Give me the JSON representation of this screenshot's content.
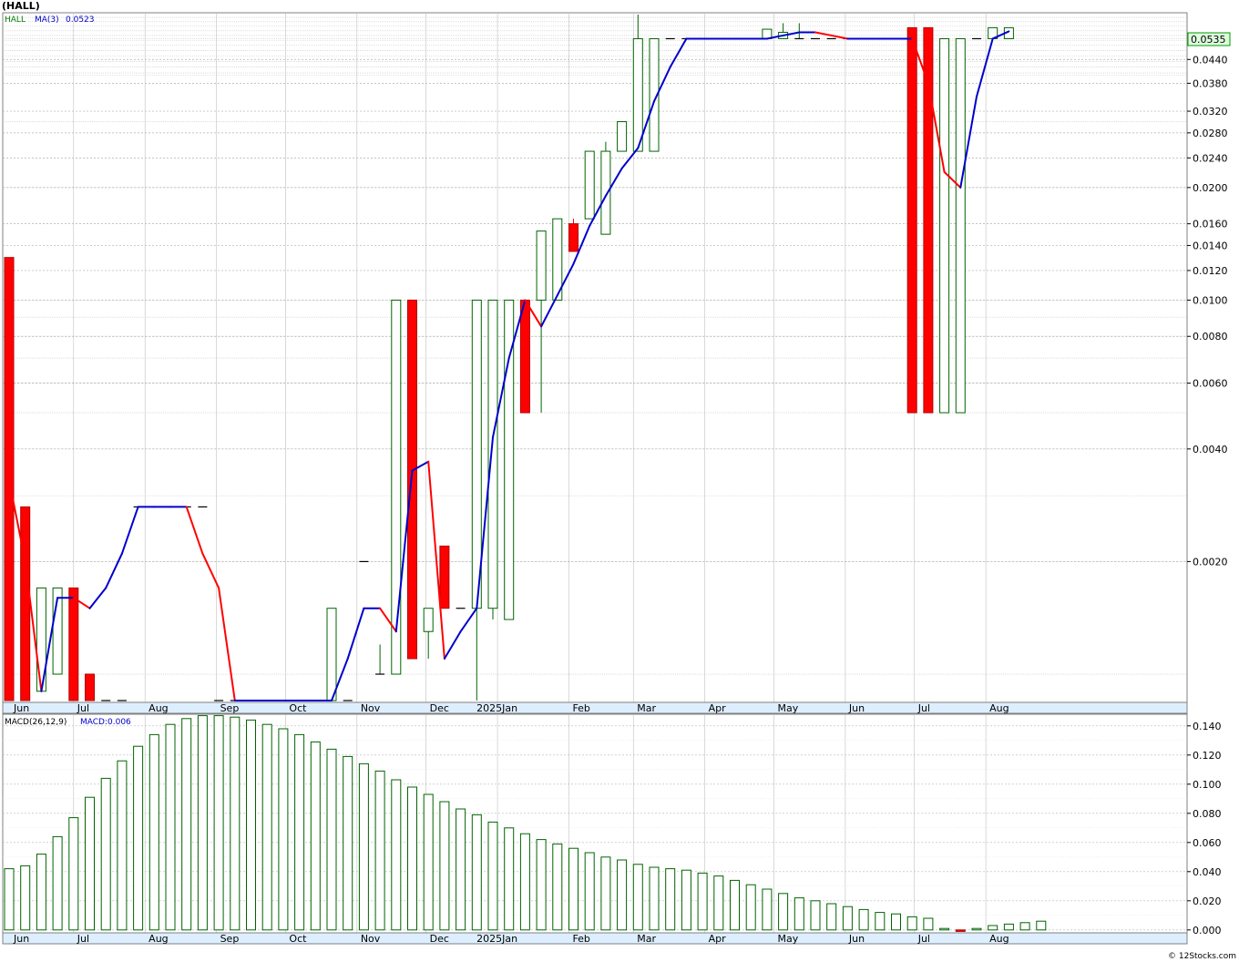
{
  "title": "(HALL)",
  "price_panel": {
    "legend": [
      {
        "label": "HALL",
        "color": "#008000"
      },
      {
        "label": "MA(3)",
        "color": "#0000cc"
      },
      {
        "label": "0.0523",
        "color": "#0000cc"
      }
    ],
    "last_price_label": "0.0535",
    "last_price": 0.0535,
    "y_ticks": [
      "0.0440",
      "0.0380",
      "0.0320",
      "0.0280",
      "0.0240",
      "0.0200",
      "0.0160",
      "0.0140",
      "0.0120",
      "0.0100",
      "0.0080",
      "0.0060",
      "0.0040",
      "0.0020"
    ]
  },
  "macd_panel": {
    "legend": [
      {
        "label": "MACD(26,12,9)",
        "color": "#000000"
      },
      {
        "label": "MACD:0.006",
        "color": "#0000cc"
      }
    ],
    "y_ticks": [
      "0.140",
      "0.120",
      "0.100",
      "0.080",
      "0.060",
      "0.040",
      "0.020",
      "0.000"
    ]
  },
  "x_labels": [
    "Jun",
    "Jul",
    "Aug",
    "Sep",
    "Oct",
    "Nov",
    "Dec",
    "2025Jan",
    "Feb",
    "Mar",
    "Apr",
    "May",
    "Jun",
    "Jul",
    "Aug"
  ],
  "footer": "© 12Stocks.com",
  "chart_data": [
    {
      "type": "candlestick",
      "title": "(HALL)",
      "scale": "log",
      "ylim": [
        0.00085,
        0.058
      ],
      "colors": {
        "up": "#006400",
        "down": "#ff0000",
        "ma_up": "#0000cc",
        "ma_down": "#ff0000"
      },
      "x": [
        "2024-06-03",
        "2024-06-10",
        "2024-06-17",
        "2024-06-24",
        "2024-07-01",
        "2024-07-08",
        "2024-07-15",
        "2024-07-22",
        "2024-07-29",
        "2024-08-05",
        "2024-08-12",
        "2024-08-19",
        "2024-08-26",
        "2024-09-02",
        "2024-09-09",
        "2024-09-16",
        "2024-09-23",
        "2024-09-30",
        "2024-10-07",
        "2024-10-14",
        "2024-10-21",
        "2024-10-28",
        "2024-11-04",
        "2024-11-11",
        "2024-11-18",
        "2024-11-25",
        "2024-12-02",
        "2024-12-09",
        "2024-12-16",
        "2024-12-23",
        "2024-12-30",
        "2025-01-06",
        "2025-01-13",
        "2025-01-20",
        "2025-01-27",
        "2025-02-03",
        "2025-02-10",
        "2025-02-17",
        "2025-02-24",
        "2025-03-03",
        "2025-03-10",
        "2025-03-17",
        "2025-03-24",
        "2025-03-31",
        "2025-04-07",
        "2025-04-14",
        "2025-04-21",
        "2025-04-28",
        "2025-05-05",
        "2025-05-12",
        "2025-05-19",
        "2025-05-26",
        "2025-06-02",
        "2025-06-09",
        "2025-06-16",
        "2025-06-23",
        "2025-06-30",
        "2025-07-07",
        "2025-07-14",
        "2025-07-21",
        "2025-07-28",
        "2025-08-04",
        "2025-08-11"
      ],
      "open": [
        0.013,
        0.0028,
        0.0009,
        0.001,
        0.0017,
        0.001,
        0.00085,
        0.00085,
        0.0028,
        0.0028,
        0.0028,
        0.0028,
        0.0028,
        0.00085,
        0.00085,
        0.00085,
        0.00085,
        0.00085,
        0.00085,
        0.00085,
        0.00085,
        0.00085,
        0.002,
        0.001,
        0.001,
        0.01,
        0.0013,
        0.0022,
        0.0015,
        0.0015,
        0.0015,
        0.0014,
        0.01,
        0.01,
        0.01,
        0.016,
        0.0165,
        0.015,
        0.025,
        0.025,
        0.025,
        0.05,
        0.05,
        0.05,
        0.05,
        0.05,
        0.05,
        0.05,
        0.05,
        0.05,
        0.05,
        0.05,
        0.05,
        0.05,
        0.05,
        0.05,
        0.0535,
        0.0535,
        0.005,
        0.005,
        0.05,
        0.05,
        0.05
      ],
      "high": [
        0.013,
        0.0028,
        0.0017,
        0.0017,
        0.0017,
        0.001,
        0.00085,
        0.00085,
        0.0028,
        0.0028,
        0.0028,
        0.0028,
        0.0028,
        0.00085,
        0.00085,
        0.00085,
        0.00085,
        0.00085,
        0.00085,
        0.00085,
        0.0015,
        0.00085,
        0.002,
        0.0012,
        0.01,
        0.01,
        0.0015,
        0.0022,
        0.0015,
        0.01,
        0.01,
        0.01,
        0.01,
        0.0153,
        0.0165,
        0.0165,
        0.025,
        0.0265,
        0.03,
        0.058,
        0.05,
        0.05,
        0.05,
        0.05,
        0.05,
        0.05,
        0.05,
        0.053,
        0.055,
        0.055,
        0.05,
        0.05,
        0.05,
        0.05,
        0.05,
        0.05,
        0.0535,
        0.0535,
        0.005,
        0.05,
        0.05,
        0.05,
        0.0535
      ],
      "low": [
        0.00085,
        0.00085,
        0.0009,
        0.001,
        0.001,
        0.00085,
        0.00085,
        0.00085,
        0.0028,
        0.0028,
        0.0028,
        0.0028,
        0.0028,
        0.00085,
        0.00085,
        0.00085,
        0.00085,
        0.00085,
        0.00085,
        0.00085,
        0.00085,
        0.00085,
        0.002,
        0.001,
        0.001,
        0.0011,
        0.0011,
        0.0015,
        0.0015,
        0.00085,
        0.0014,
        0.005,
        0.005,
        0.005,
        0.0135,
        0.0135,
        0.0245,
        0.025,
        0.025,
        0.038,
        0.05,
        0.05,
        0.05,
        0.05,
        0.05,
        0.05,
        0.05,
        0.05,
        0.052,
        0.05,
        0.05,
        0.05,
        0.05,
        0.05,
        0.05,
        0.05,
        0.005,
        0.005,
        0.005,
        0.005,
        0.05,
        0.05,
        0.05
      ],
      "close": [
        0.00085,
        0.00085,
        0.0017,
        0.0017,
        0.00085,
        0.00085,
        0.00085,
        0.00085,
        0.0028,
        0.0028,
        0.0028,
        0.0028,
        0.0028,
        0.00085,
        0.00085,
        0.00085,
        0.00085,
        0.00085,
        0.00085,
        0.00085,
        0.0015,
        0.00085,
        0.002,
        0.001,
        0.01,
        0.0011,
        0.0015,
        0.0015,
        0.0015,
        0.01,
        0.01,
        0.01,
        0.005,
        0.0153,
        0.0165,
        0.0135,
        0.025,
        0.025,
        0.03,
        0.05,
        0.05,
        0.05,
        0.05,
        0.05,
        0.05,
        0.05,
        0.05,
        0.053,
        0.052,
        0.05,
        0.05,
        0.05,
        0.05,
        0.05,
        0.05,
        0.05,
        0.005,
        0.005,
        0.05,
        0.05,
        0.05,
        0.0535,
        0.0535
      ],
      "series": [
        {
          "name": "MA(3)",
          "values": [
            0.0033,
            0.002,
            0.0009,
            0.0016,
            0.0016,
            0.0015,
            0.0017,
            0.0021,
            0.0028,
            0.0028,
            0.0028,
            0.0028,
            0.0021,
            0.0017,
            0.00085,
            0.00085,
            0.00085,
            0.00085,
            0.00085,
            0.00085,
            0.00085,
            0.0011,
            0.0015,
            0.0015,
            0.0013,
            0.0035,
            0.0037,
            0.0011,
            0.0013,
            0.0015,
            0.0043,
            0.007,
            0.01,
            0.0085,
            0.0103,
            0.0125,
            0.0158,
            0.019,
            0.0225,
            0.0255,
            0.034,
            0.042,
            0.05,
            0.05,
            0.05,
            0.05,
            0.05,
            0.05,
            0.051,
            0.052,
            0.052,
            0.051,
            0.05,
            0.05,
            0.05,
            0.05,
            0.05,
            0.038,
            0.022,
            0.02,
            0.035,
            0.05,
            0.0523
          ]
        }
      ]
    },
    {
      "type": "bar",
      "title": "MACD(26,12,9)",
      "ylim": [
        -0.002,
        0.148
      ],
      "values": [
        0.042,
        0.044,
        0.052,
        0.064,
        0.077,
        0.091,
        0.104,
        0.116,
        0.126,
        0.134,
        0.141,
        0.145,
        0.147,
        0.147,
        0.146,
        0.144,
        0.141,
        0.138,
        0.134,
        0.129,
        0.124,
        0.119,
        0.114,
        0.109,
        0.103,
        0.098,
        0.093,
        0.088,
        0.083,
        0.079,
        0.074,
        0.07,
        0.066,
        0.062,
        0.059,
        0.056,
        0.053,
        0.05,
        0.048,
        0.045,
        0.043,
        0.042,
        0.041,
        0.039,
        0.037,
        0.034,
        0.031,
        0.028,
        0.025,
        0.022,
        0.02,
        0.018,
        0.016,
        0.014,
        0.012,
        0.011,
        0.009,
        0.008,
        0.001,
        -0.001,
        0.001,
        0.003,
        0.004,
        0.005,
        0.006
      ]
    }
  ]
}
